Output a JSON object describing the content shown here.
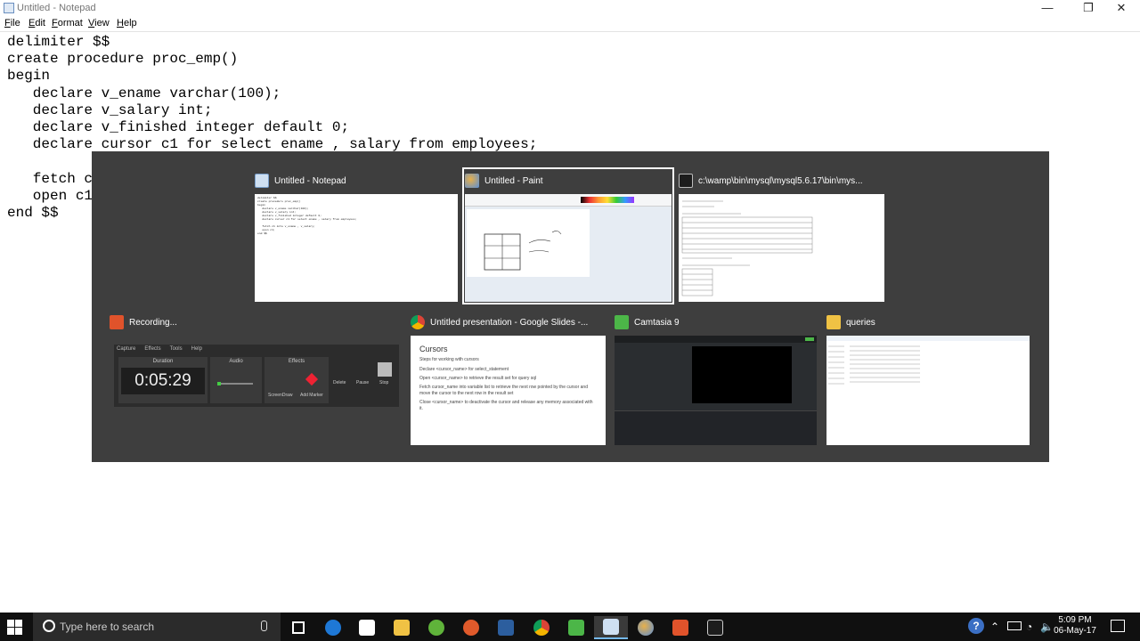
{
  "window": {
    "title": "Untitled - Notepad",
    "controls": {
      "minimize": "—",
      "maximize": "❐",
      "close": "✕"
    }
  },
  "menu": [
    "File",
    "Edit",
    "Format",
    "View",
    "Help"
  ],
  "editor": {
    "code": "delimiter $$\ncreate procedure proc_emp()\nbegin\n   declare v_ename varchar(100);\n   declare v_salary int;\n   declare v_finished integer default 0;\n   declare cursor c1 for select ename , salary from employees;\n\n   fetch c1 into v_ename , v_salary;\n   open c1;\nend $$"
  },
  "switcher": {
    "windows": [
      {
        "title": "Untitled - Notepad",
        "icon": "notepad-icon"
      },
      {
        "title": "Untitled - Paint",
        "icon": "paint-icon"
      },
      {
        "title": "c:\\wamp\\bin\\mysql\\mysql5.6.17\\bin\\mys...",
        "icon": "console-icon"
      },
      {
        "title": "Recording...",
        "icon": "camtasia-recorder-icon"
      },
      {
        "title": "Untitled presentation - Google Slides -...",
        "icon": "chrome-icon"
      },
      {
        "title": "Camtasia 9",
        "icon": "camtasia-icon"
      },
      {
        "title": "queries",
        "icon": "folder-icon"
      }
    ],
    "recorder": {
      "menu": [
        "Capture",
        "Effects",
        "Tools",
        "Help"
      ],
      "duration_label": "Duration",
      "audio_label": "Audio",
      "effects_label": "Effects",
      "time": "0:05:29",
      "screendraw": "ScreenDraw",
      "add_marker": "Add Marker",
      "delete": "Delete",
      "pause": "Pause",
      "stop": "Stop"
    },
    "slides": {
      "heading": "Cursors",
      "intro": "Steps for working with cursors",
      "bullets": [
        "Declare <cursor_name> for select_statement",
        "Open <cursor_name> to retrieve the result set for query sql",
        "Fetch cursor_name into variable list to retrieve the next row pointed by the cursor and move the cursor to the next row in the result set",
        "Close <cursor_name> to deactivate the cursor and release any memory associated with it."
      ]
    }
  },
  "taskbar": {
    "search_placeholder": "Type here to search",
    "time": "5:09 PM",
    "date": "06-May-17",
    "colors": {
      "bg": "#101010",
      "accent": "#76b9ed"
    }
  }
}
